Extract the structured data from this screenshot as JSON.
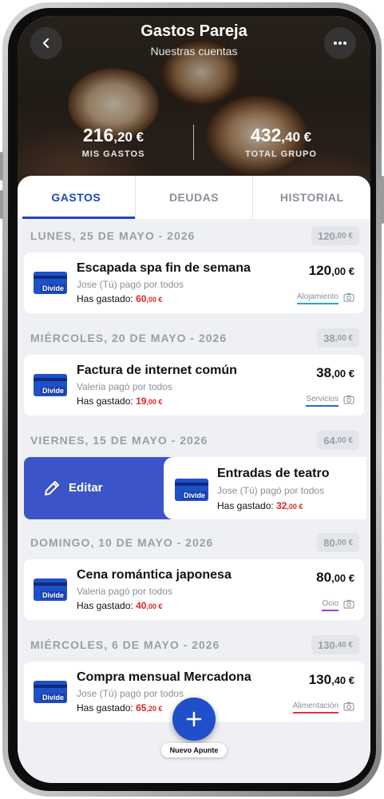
{
  "header": {
    "title": "Gastos Pareja",
    "subtitle": "Nuestras cuentas",
    "back_icon": "chevron-left-icon",
    "more_icon": "more-horizontal-icon"
  },
  "stats": {
    "mine": {
      "int": "216",
      "dec": ",20 €",
      "label": "MIS GASTOS"
    },
    "group": {
      "int": "432",
      "dec": ",40 €",
      "label": "TOTAL GRUPO"
    }
  },
  "tabs": [
    {
      "label": "GASTOS",
      "active": true
    },
    {
      "label": "DEUDAS",
      "active": false
    },
    {
      "label": "HISTORIAL",
      "active": false
    }
  ],
  "common": {
    "spent_label": "Has gastado:",
    "logo_text": "Divide"
  },
  "days": [
    {
      "date": "LUNES, 25 DE MAYO - 2026",
      "total_int": "120",
      "total_dec": ",00 €",
      "expense": {
        "title": "Escapada spa fin de semana",
        "payer": "Jose (Tú) pagó por todos",
        "spent_int": "60",
        "spent_dec": ",00 €",
        "amount_int": "120",
        "amount_dec": ",00 €",
        "category": "Alojamiento",
        "category_color": "#1fa8d6"
      }
    },
    {
      "date": "MIÉRCOLES, 20 DE MAYO - 2026",
      "total_int": "38",
      "total_dec": ",00 €",
      "expense": {
        "title": "Factura de internet común",
        "payer": "Valeria pagó por todos",
        "spent_int": "19",
        "spent_dec": ",00 €",
        "amount_int": "38",
        "amount_dec": ",00 €",
        "category": "Servicios",
        "category_color": "#2f63d6"
      }
    },
    {
      "date": "VIERNES, 15 DE MAYO - 2026",
      "total_int": "64",
      "total_dec": ",00 €",
      "expense": {
        "title": "Entradas de teatro",
        "payer": "Jose (Tú) pagó por todos",
        "spent_int": "32",
        "spent_dec": ",00 €",
        "swiped": true,
        "swipe_action": "Editar"
      }
    },
    {
      "date": "DOMINGO, 10 DE MAYO - 2026",
      "total_int": "80",
      "total_dec": ",00 €",
      "expense": {
        "title": "Cena romántica japonesa",
        "payer": "Valeria pagó por todos",
        "spent_int": "40",
        "spent_dec": ",00 €",
        "amount_int": "80",
        "amount_dec": ",00 €",
        "category": "Ocio",
        "category_color": "#9b3fd1"
      }
    },
    {
      "date": "MIÉRCOLES, 6 DE MAYO - 2026",
      "total_int": "130",
      "total_dec": ",40 €",
      "expense": {
        "title": "Compra mensual Mercadona",
        "payer": "Jose (Tú) pagó por todos",
        "spent_int": "65",
        "spent_dec": ",20 €",
        "amount_int": "130",
        "amount_dec": ",40 €",
        "category": "Alimentación",
        "category_color": "#e0323a"
      }
    }
  ],
  "fab": {
    "label": "Nuevo Apunte",
    "icon": "plus-icon"
  },
  "colors": {
    "accent": "#1d46b8",
    "spent": "#e02525",
    "edit_bg": "#3b55c9"
  }
}
